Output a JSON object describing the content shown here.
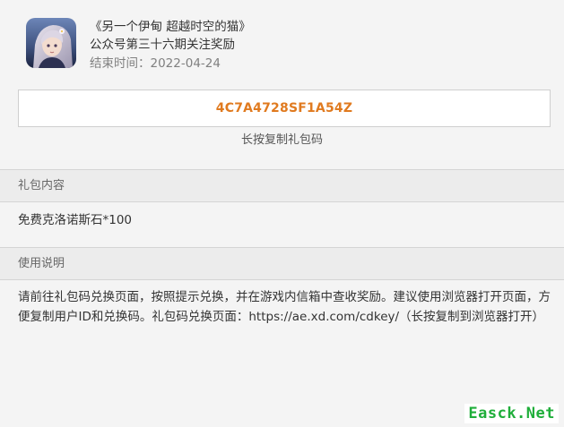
{
  "header": {
    "title": "《另一个伊甸 超越时空的猫》",
    "subtitle": "公众号第三十六期关注奖励",
    "end_time": "结束时间：2022-04-24"
  },
  "code": {
    "value": "4C7A4728SF1A54Z",
    "hint": "长按复制礼包码"
  },
  "contents": {
    "title": "礼包内容",
    "body": "免费克洛诺斯石*100"
  },
  "usage": {
    "title": "使用说明",
    "body": "请前往礼包码兑换页面，按照提示兑换，并在游戏内信箱中查收奖励。建议使用浏览器打开页面，方便复制用户ID和兑换码。礼包码兑换页面：https://ae.xd.com/cdkey/（长按复制到浏览器打开）"
  },
  "watermark": {
    "text": "Easck.Net"
  },
  "colors": {
    "accent": "#e07a1f",
    "watermark": "#1fae3a"
  },
  "icons": {
    "app_icon": "game-character-icon"
  }
}
